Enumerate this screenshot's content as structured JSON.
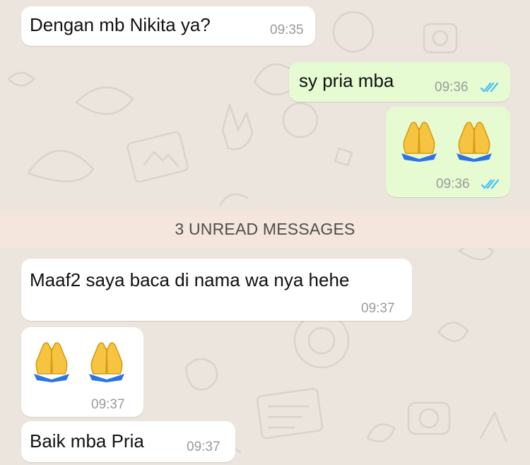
{
  "colors": {
    "wallpaper": "#ece5dd",
    "incoming_bubble": "#ffffff",
    "outgoing_bubble": "#e6fbd1",
    "read_ticks": "#4fc3f7",
    "unread_banner": "#f4e6dc"
  },
  "messages": [
    {
      "direction": "incoming",
      "text": "Dengan mb Nikita ya?",
      "time": "09:35"
    },
    {
      "direction": "outgoing",
      "text": "sy pria mba",
      "time": "09:36",
      "status_icon": "double-check-read-icon"
    },
    {
      "direction": "outgoing",
      "emoji": "🙏🙏",
      "emoji_names": [
        "folded-hands-emoji",
        "folded-hands-emoji"
      ],
      "time": "09:36",
      "status_icon": "double-check-read-icon"
    },
    {
      "direction": "incoming",
      "text": "Maaf2 saya baca di nama wa nya hehe",
      "time": "09:37"
    },
    {
      "direction": "incoming",
      "emoji": "🙏🙏",
      "emoji_names": [
        "folded-hands-emoji",
        "folded-hands-emoji"
      ],
      "time": "09:37"
    },
    {
      "direction": "incoming",
      "text": "Baik mba Pria",
      "time": "09:37"
    }
  ],
  "unread_banner": {
    "text": "3 UNREAD MESSAGES"
  }
}
